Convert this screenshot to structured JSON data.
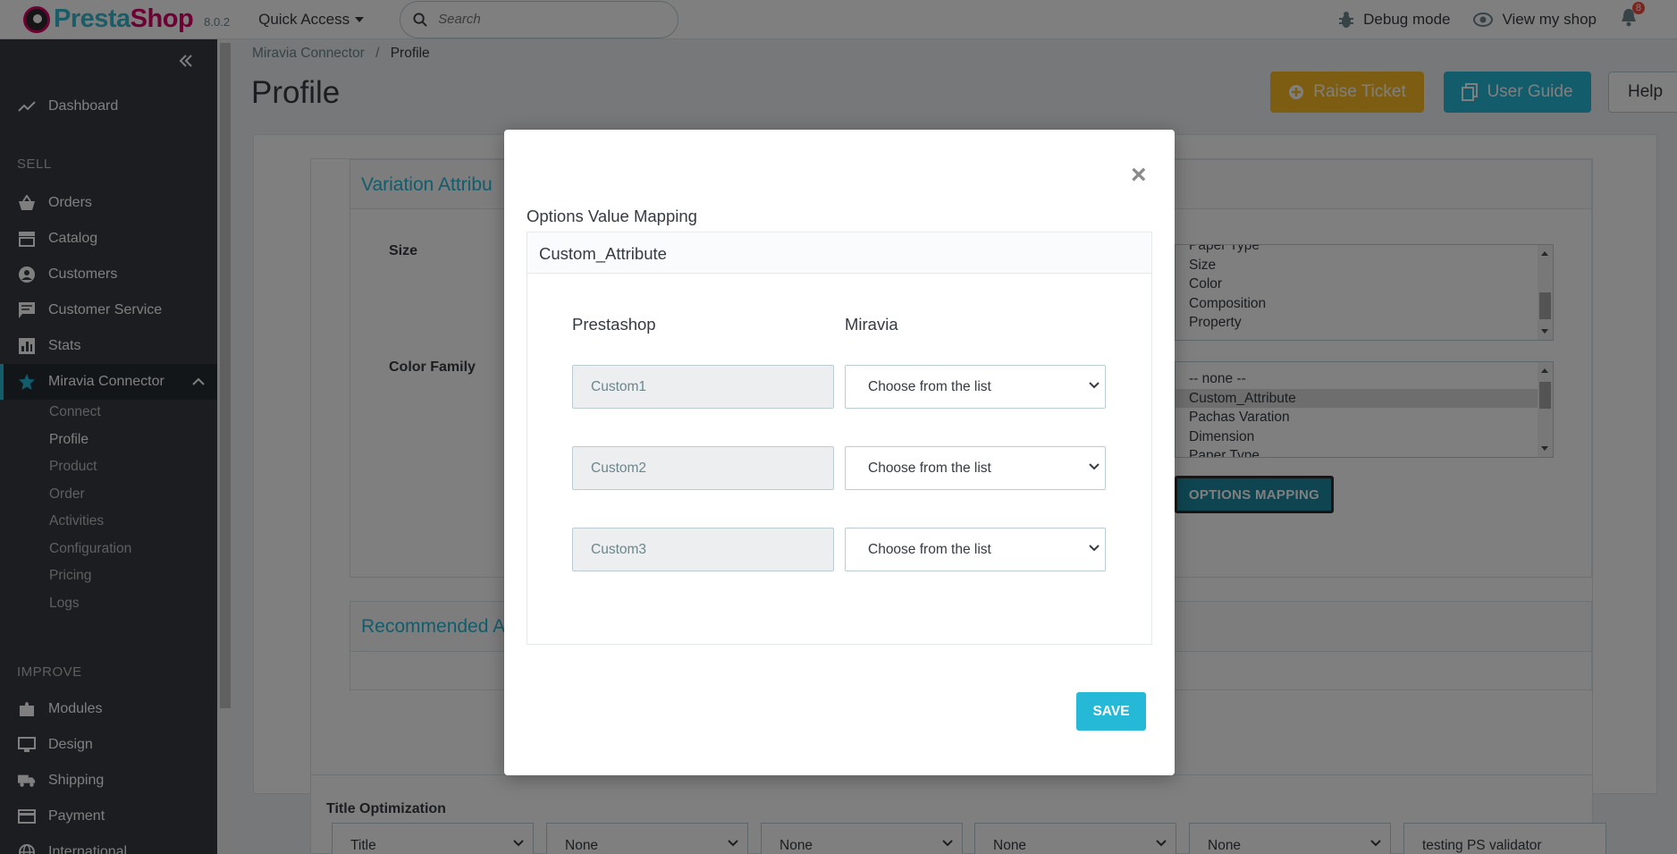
{
  "header": {
    "logo_text_a": "Presta",
    "logo_text_b": "Shop",
    "version": "8.0.2",
    "quick_access": "Quick Access",
    "search_placeholder": "Search",
    "debug_mode": "Debug mode",
    "view_shop": "View my shop",
    "notifications": "8"
  },
  "sidebar": {
    "dashboard": "Dashboard",
    "section_sell": "SELL",
    "orders": "Orders",
    "catalog": "Catalog",
    "customers": "Customers",
    "customer_service": "Customer Service",
    "stats": "Stats",
    "miravia": "Miravia Connector",
    "sub": [
      "Connect",
      "Profile",
      "Product",
      "Order",
      "Activities",
      "Configuration",
      "Pricing",
      "Logs"
    ],
    "section_improve": "IMPROVE",
    "modules": "Modules",
    "design": "Design",
    "shipping": "Shipping",
    "payment": "Payment",
    "international": "International"
  },
  "page": {
    "breadcrumb_parent": "Miravia Connector",
    "breadcrumb_sep": "/",
    "breadcrumb_current": "Profile",
    "title": "Profile",
    "raise_ticket": "Raise Ticket",
    "user_guide": "User Guide",
    "help": "Help",
    "variation_title": "Variation Attribu",
    "label_size": "Size",
    "label_color_family": "Color Family",
    "size_options": [
      "Paper Type",
      "Size",
      "Color",
      "Composition",
      "Property"
    ],
    "color_options": [
      "-- none --",
      "Custom_Attribute",
      "Pachas Varation",
      "Dimension",
      "Paper Type"
    ],
    "options_mapping": "OPTIONS MAPPING",
    "recommended_title": "Recommended A",
    "title_optimization": "Title Optimization",
    "title_selects": [
      "Title",
      "None",
      "None",
      "None",
      "None"
    ],
    "title_input_value": "testing PS validator"
  },
  "modal": {
    "label": "Options Value Mapping",
    "card_title": "Custom_Attribute",
    "col_prestashop": "Prestashop",
    "col_miravia": "Miravia",
    "rows": [
      {
        "prestashop": "Custom1",
        "miravia": "Choose from the list"
      },
      {
        "prestashop": "Custom2",
        "miravia": "Choose from the list"
      },
      {
        "prestashop": "Custom3",
        "miravia": "Choose from the list"
      }
    ],
    "close": "×",
    "save": "SAVE"
  },
  "colors": {
    "accent": "#25b9d7",
    "sidebar_bg": "#363a41",
    "raise_ticket": "#fbbb22",
    "options_btn": "#1c8aa1"
  }
}
